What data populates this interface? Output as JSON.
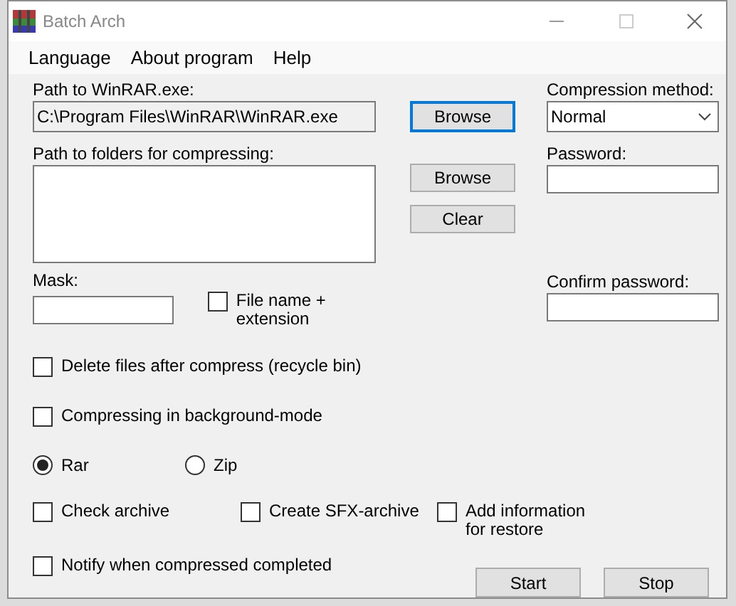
{
  "window": {
    "title": "Batch Arch"
  },
  "menu": [
    "Language",
    "About program",
    "Help"
  ],
  "winrar_path": {
    "label": "Path to WinRAR.exe:",
    "value": "C:\\Program Files\\WinRAR\\WinRAR.exe",
    "disabled": true
  },
  "browse_winrar_button": {
    "label": "Browse",
    "focused": true
  },
  "folders": {
    "label": "Path to folders for compressing:"
  },
  "folder_buttons": [
    "Browse",
    "Clear"
  ],
  "compression_method": {
    "label": "Compression method:",
    "value": "Normal"
  },
  "password": {
    "label": "Password:"
  },
  "mask": {
    "label": "Mask:"
  },
  "filename_extension": {
    "label": "File name + extension",
    "checked": false
  },
  "confirm_password": {
    "label": "Confirm password:"
  },
  "delete_files": {
    "label": "Delete files after compress (recycle bin)",
    "checked": false
  },
  "background_mode": {
    "label": "Compressing in background-mode",
    "checked": false
  },
  "format": [
    {
      "label": "Rar",
      "selected": true
    },
    {
      "label": "Zip",
      "selected": false
    }
  ],
  "archive_options": [
    {
      "label": "Check archive",
      "checked": false
    },
    {
      "label": "Create SFX-archive",
      "checked": false
    },
    {
      "label": "Add information\n for restore",
      "checked": false
    }
  ],
  "notify": {
    "label": "Notify when compressed completed",
    "checked": false
  },
  "buttons": [
    "Start",
    "Stop"
  ]
}
